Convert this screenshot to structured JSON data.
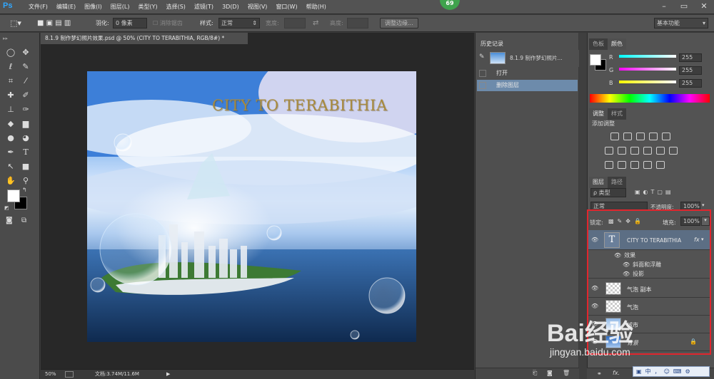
{
  "app": {
    "logo": "Ps",
    "notification_count": "69"
  },
  "menu": [
    "文件(F)",
    "编辑(E)",
    "图像(I)",
    "图层(L)",
    "类型(Y)",
    "选择(S)",
    "滤镜(T)",
    "3D(D)",
    "视图(V)",
    "窗口(W)",
    "帮助(H)"
  ],
  "options": {
    "feather_label": "羽化:",
    "feather_value": "0 像素",
    "antialias": "消除锯齿",
    "style_label": "样式:",
    "style_value": "正常",
    "width_label": "宽度:",
    "height_label": "高度:",
    "refine_edge": "调整边缘...",
    "workspace": "基本功能"
  },
  "document": {
    "tab_title": "8.1.9 制作梦幻照片效果.psd @ 50% (CITY  TO  TERABITHIA, RGB/8#) *",
    "canvas_title": "CITY TO TERABITHIA",
    "zoom": "50%",
    "doc_info": "文档:3.74M/11.6M"
  },
  "history": {
    "tab": "历史记录",
    "snapshot": "8.1.9 制作梦幻照片...",
    "items": [
      "打开",
      "删除图层"
    ]
  },
  "color": {
    "tab_swatches": "色板",
    "tab_color": "颜色",
    "r_label": "R",
    "g_label": "G",
    "b_label": "B",
    "r": "255",
    "g": "255",
    "b": "255"
  },
  "adjustments": {
    "tab": "调整",
    "tab_styles": "样式",
    "add_label": "添加调整"
  },
  "layers": {
    "tab": "图层",
    "tab_paths": "路径",
    "filter": "ρ 类型",
    "blend": "正常",
    "opacity_label": "不透明度:",
    "opacity": "100%",
    "lock_label": "锁定:",
    "fill_label": "填充:",
    "fill": "100%",
    "items": [
      {
        "name": "CITY  TO  TERABITHIA"
      },
      {
        "name": "气泡 副本"
      },
      {
        "name": "气泡"
      },
      {
        "name": "城市"
      },
      {
        "name": "背景"
      }
    ],
    "effects_label": "效果",
    "effect1": "斜面和浮雕",
    "effect2": "投影"
  },
  "watermark": {
    "main": "Bai经验",
    "url": "jingyan.baidu.com"
  },
  "ime": [
    "中",
    "，",
    "☺"
  ]
}
